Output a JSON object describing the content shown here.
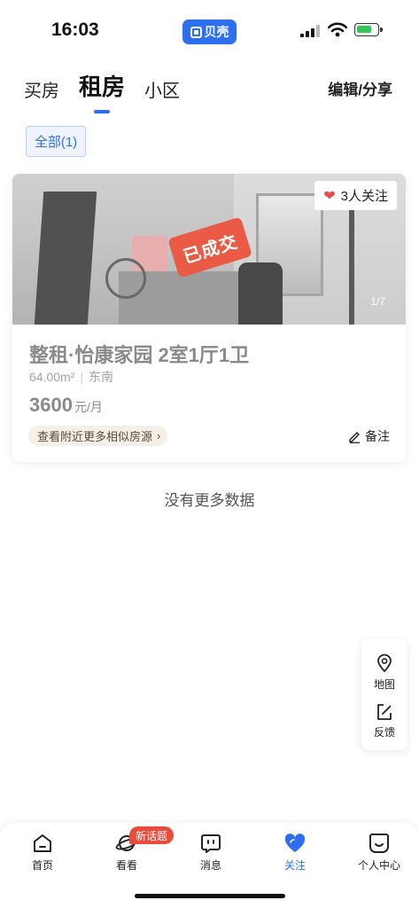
{
  "status_bar": {
    "time": "16:03",
    "app_pill": "贝壳",
    "battery_color": "#32c659"
  },
  "header": {
    "tabs": [
      {
        "label": "买房"
      },
      {
        "label": "租房",
        "active": true
      },
      {
        "label": "小区"
      }
    ],
    "edit_share": "编辑/分享"
  },
  "filter": {
    "chip": "全部(1)"
  },
  "listing": {
    "follow_count": "3人关注",
    "stamp": "已成交",
    "image_counter": "1/7",
    "title": "整租·怡康家园 2室1厅1卫",
    "area": "64.00m²",
    "orientation": "东南",
    "price": "3600",
    "price_unit": "元/月",
    "nearby_link": "查看附近更多相似房源",
    "note_label": "备注"
  },
  "end_text": "没有更多数据",
  "float_panel": {
    "map_label": "地图",
    "feedback_label": "反馈"
  },
  "bottom_nav": {
    "items": [
      {
        "label": "首页",
        "icon": "home-icon"
      },
      {
        "label": "看看",
        "icon": "planet-icon"
      },
      {
        "label": "消息",
        "icon": "message-icon"
      },
      {
        "label": "关注",
        "icon": "heart-icon",
        "active": true
      },
      {
        "label": "个人中心",
        "icon": "smile-icon"
      }
    ],
    "badge": "新话题"
  },
  "colors": {
    "accent": "#2d6ff0",
    "stamp_red": "#ea5a45",
    "heart_red": "#ea4a4a"
  }
}
